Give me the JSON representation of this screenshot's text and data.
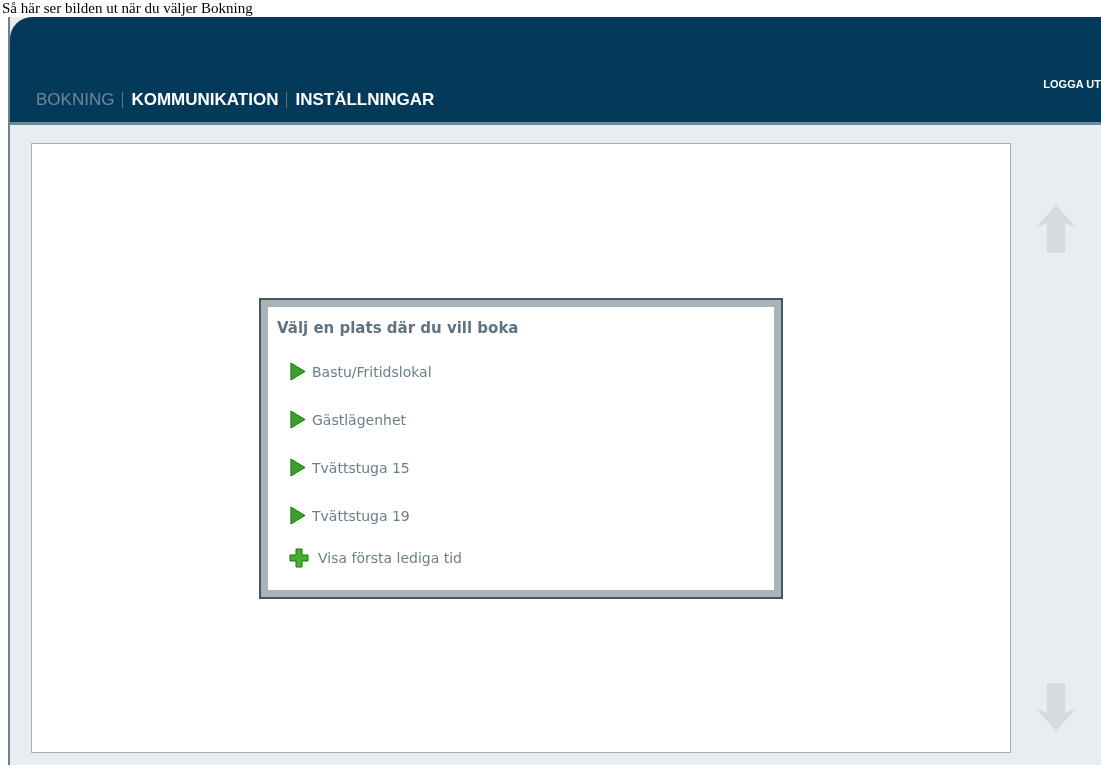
{
  "caption": "Så här ser bilden ut när du väljer Bokning",
  "nav": [
    {
      "label": "BOKNING",
      "selected": true
    },
    {
      "label": "KOMMUNIKATION",
      "selected": false
    },
    {
      "label": "INSTÄLLNINGAR",
      "selected": false
    }
  ],
  "logout": "LOGGA UT",
  "dialog": {
    "title": "Välj en plats där du vill boka",
    "items": [
      {
        "label": "Bastu/Fritidslokal",
        "kind": "place"
      },
      {
        "label": "Gästlägenhet",
        "kind": "place"
      },
      {
        "label": "Tvättstuga 15",
        "kind": "place"
      },
      {
        "label": "Tvättstuga 19",
        "kind": "place"
      },
      {
        "label": "Visa första lediga tid",
        "kind": "action"
      }
    ]
  }
}
